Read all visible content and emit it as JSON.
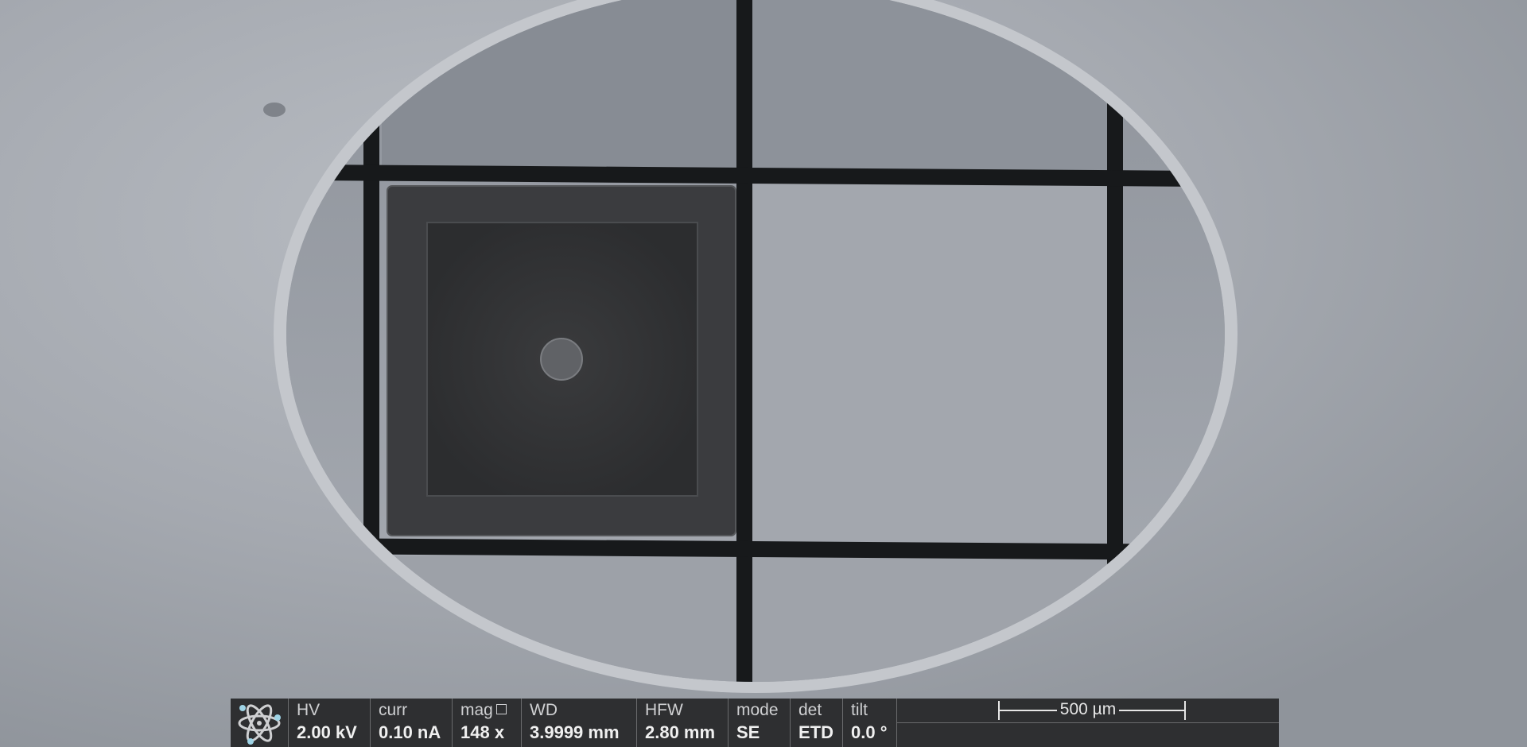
{
  "databar": {
    "hv": {
      "label": "HV",
      "value": "2.00 kV"
    },
    "curr": {
      "label": "curr",
      "value": "0.10 nA"
    },
    "mag": {
      "label": "mag",
      "value": "148 x"
    },
    "wd": {
      "label": "WD",
      "value": "3.9999 mm"
    },
    "hfw": {
      "label": "HFW",
      "value": "2.80 mm"
    },
    "mode": {
      "label": "mode",
      "value": "SE"
    },
    "det": {
      "label": "det",
      "value": "ETD"
    },
    "tilt": {
      "label": "tilt",
      "value": "0.0 °"
    },
    "scale_bar": {
      "label": "500 µm"
    }
  },
  "icons": {
    "logo": "atom-icon",
    "mag_indicator": "square-icon"
  },
  "colors": {
    "databar_bg": "#2e2f31",
    "databar_text": "#f0f0f0",
    "logo_accent": "#9fd4e6",
    "grid_bar": "#17191b",
    "holder_surface": "#a6aab1"
  }
}
